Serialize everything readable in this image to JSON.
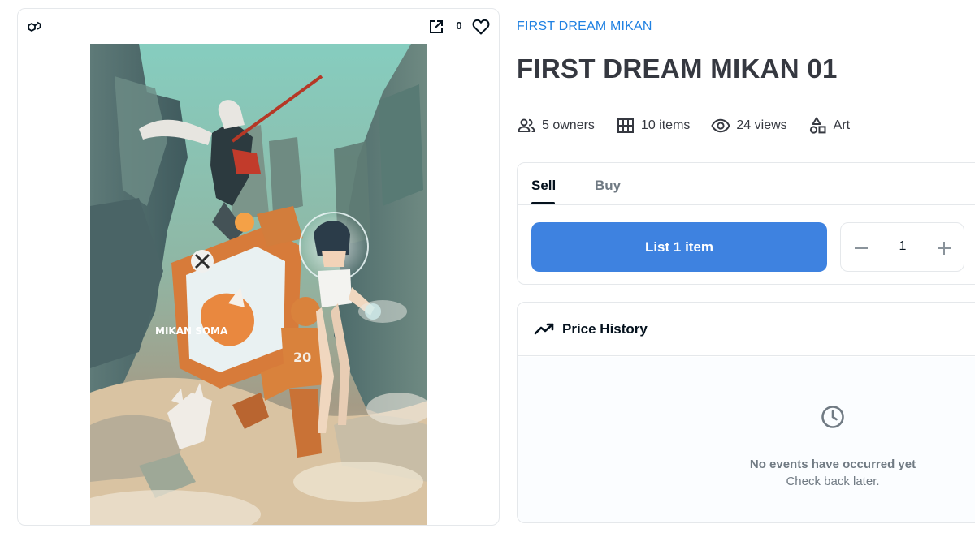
{
  "card": {
    "favorite_count": "0",
    "artwork_caption": "MIKAN SOMA"
  },
  "collection": {
    "name": "FIRST DREAM MIKAN"
  },
  "item": {
    "title": "FIRST DREAM MIKAN 01"
  },
  "stats": {
    "owners": "5 owners",
    "items": "10 items",
    "views": "24 views",
    "category": "Art"
  },
  "trade": {
    "tabs": [
      "Sell",
      "Buy"
    ],
    "active_tab": "Sell",
    "list_button": "List 1 item",
    "quantity": "1"
  },
  "price_history": {
    "title": "Price History",
    "empty_title": "No events have occurred yet",
    "empty_subtitle": "Check back later."
  },
  "colors": {
    "accent": "#2081e2",
    "button": "#3e82e0",
    "text_primary": "#04111d",
    "text_secondary": "#707a83",
    "border": "#e5e8eb"
  },
  "icons": {
    "chain": "polygon-chain-icon",
    "external": "open-external-icon",
    "favorite": "heart-icon",
    "owners": "people-icon",
    "items": "grid-icon",
    "views": "eye-icon",
    "category": "shapes-icon",
    "trend": "trending-line-icon",
    "empty": "clock-icon",
    "minus": "minus-icon",
    "plus": "plus-icon"
  }
}
